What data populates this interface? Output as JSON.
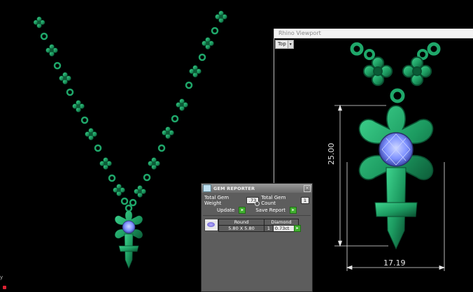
{
  "viewport": {
    "title": "Rhino Viewport",
    "view_label": "Top",
    "dimension_height": "25.00",
    "dimension_width": "17.19"
  },
  "corner_label": "y",
  "gem_reporter": {
    "title": "GEM REPORTER",
    "total_weight_label": "Total Gem Weight",
    "total_weight_value": ".73",
    "total_count_label": "Total Gem Count",
    "total_count_value": "1",
    "update_label": "Update",
    "save_label": "Save Report",
    "table": {
      "headers": [
        "Round",
        "Diamond"
      ],
      "row": {
        "size": "5.80 X 5.80",
        "count": "1",
        "weight": "0.73ct"
      }
    }
  },
  "colors": {
    "metal": "#1fa76a",
    "metal_dark": "#0b5a36",
    "stone": "#7f92ff",
    "background": "#000000"
  }
}
